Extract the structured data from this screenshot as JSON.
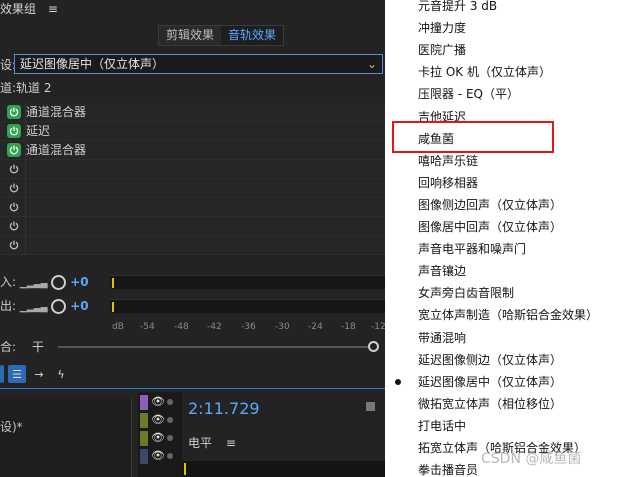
{
  "panel": {
    "title": "效果组",
    "menu_icon": "hamburger-icon",
    "tabs": [
      {
        "label": "剪辑效果",
        "active": false
      },
      {
        "label": "音轨效果",
        "active": true
      }
    ],
    "preset_label": "设:",
    "preset_value": "延迟图像居中（仅立体声）",
    "track_label": "道:轨道 2",
    "effects": [
      {
        "name": "通道混合器",
        "on": true
      },
      {
        "name": "延迟",
        "on": true
      },
      {
        "name": "通道混合器",
        "on": true
      },
      {
        "name": "",
        "on": false
      },
      {
        "name": "",
        "on": false
      },
      {
        "name": "",
        "on": false
      },
      {
        "name": "",
        "on": false
      },
      {
        "name": "",
        "on": false
      }
    ],
    "input": {
      "label": "入:",
      "value": "+0"
    },
    "output": {
      "label": "出:",
      "value": "+0"
    },
    "db_scale": [
      "dB",
      "-54",
      "-48",
      "-42",
      "-36",
      "-30",
      "-24",
      "-18",
      "-12"
    ],
    "mix": {
      "label": "合:",
      "left_label": "干"
    },
    "toolbar_icons": [
      "list-icon",
      "route-icon",
      "lightning-icon"
    ],
    "lower_text": "设)*",
    "time": "2:11.729",
    "level_label": "电平",
    "track_colors": [
      "#8c5fb8",
      "#6b7a2a",
      "#6b7a2a",
      "#3a4a6a"
    ]
  },
  "menu": {
    "items": [
      {
        "label": "元音提升 3 dB",
        "selected": false
      },
      {
        "label": "冲撞力度",
        "selected": false
      },
      {
        "label": "医院广播",
        "selected": false
      },
      {
        "label": "卡拉 OK 机（仅立体声）",
        "selected": false
      },
      {
        "label": "压限器 - EQ（平）",
        "selected": false
      },
      {
        "label": "吉他延迟",
        "selected": false
      },
      {
        "label": "咸鱼菌",
        "selected": false
      },
      {
        "label": "嘻哈声乐链",
        "selected": false
      },
      {
        "label": "回响移相器",
        "selected": false
      },
      {
        "label": "图像侧边回声（仅立体声）",
        "selected": false
      },
      {
        "label": "图像居中回声（仅立体声）",
        "selected": false
      },
      {
        "label": "声音电平器和噪声门",
        "selected": false
      },
      {
        "label": "声音镶边",
        "selected": false
      },
      {
        "label": "女声旁白齿音限制",
        "selected": false
      },
      {
        "label": "宽立体声制造（哈斯铝合金效果）",
        "selected": false
      },
      {
        "label": "带通混响",
        "selected": false
      },
      {
        "label": "延迟图像侧边（仅立体声）",
        "selected": false
      },
      {
        "label": "延迟图像居中（仅立体声）",
        "selected": true
      },
      {
        "label": "微拓宽立体声（相位移位）",
        "selected": false
      },
      {
        "label": "打电话中",
        "selected": false
      },
      {
        "label": "拓宽立体声（哈斯铝合金效果）",
        "selected": false
      },
      {
        "label": "拳击播音员",
        "selected": false
      }
    ],
    "highlight_color": "#e0161b"
  },
  "watermark": "CSDN @咸鱼菌"
}
